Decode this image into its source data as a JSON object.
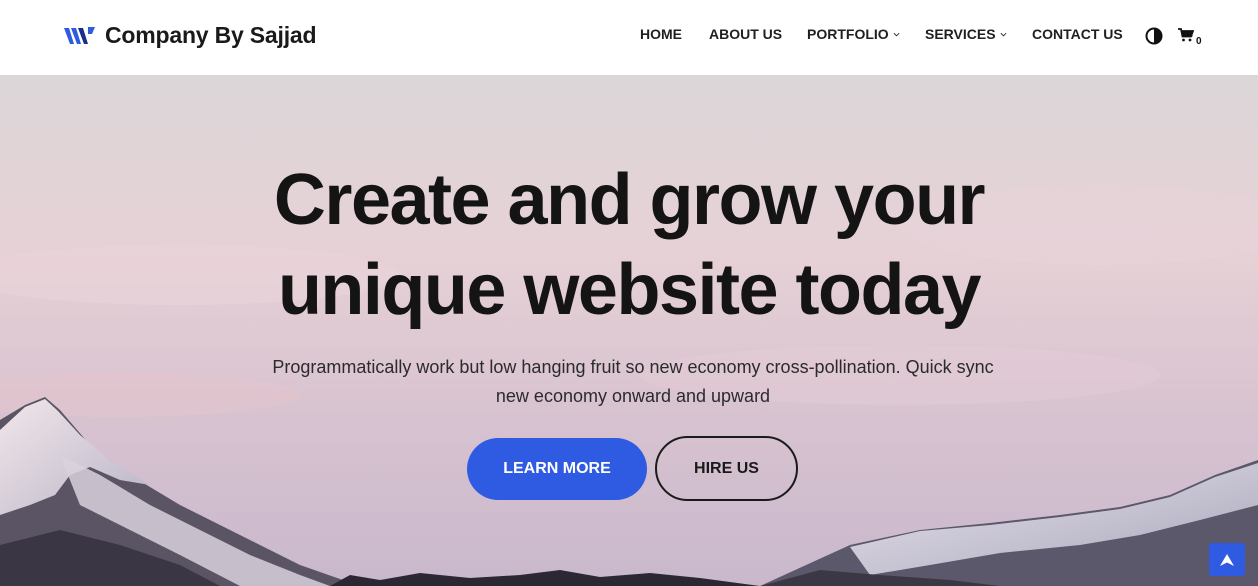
{
  "brand": {
    "name": "Company By Sajjad",
    "logo_icon": "w-logo-icon",
    "accent": "#2f5be3"
  },
  "nav": {
    "items": [
      {
        "label": "HOME",
        "dropdown": false
      },
      {
        "label": "ABOUT US",
        "dropdown": false
      },
      {
        "label": "PORTFOLIO",
        "dropdown": true
      },
      {
        "label": "SERVICES",
        "dropdown": true
      },
      {
        "label": "CONTACT US",
        "dropdown": false
      }
    ],
    "theme_icon": "half-circle-contrast-icon",
    "cart_icon": "shopping-cart-icon",
    "cart_count": "0"
  },
  "hero": {
    "title_line1": "Create and grow your",
    "title_line2": "unique website today",
    "subtitle": "Programmatically work but low hanging fruit so new economy cross-pollination. Quick sync new economy onward and upward",
    "primary_button": "LEARN MORE",
    "secondary_button": "HIRE US"
  },
  "scroll_top_icon": "arrow-up-icon"
}
